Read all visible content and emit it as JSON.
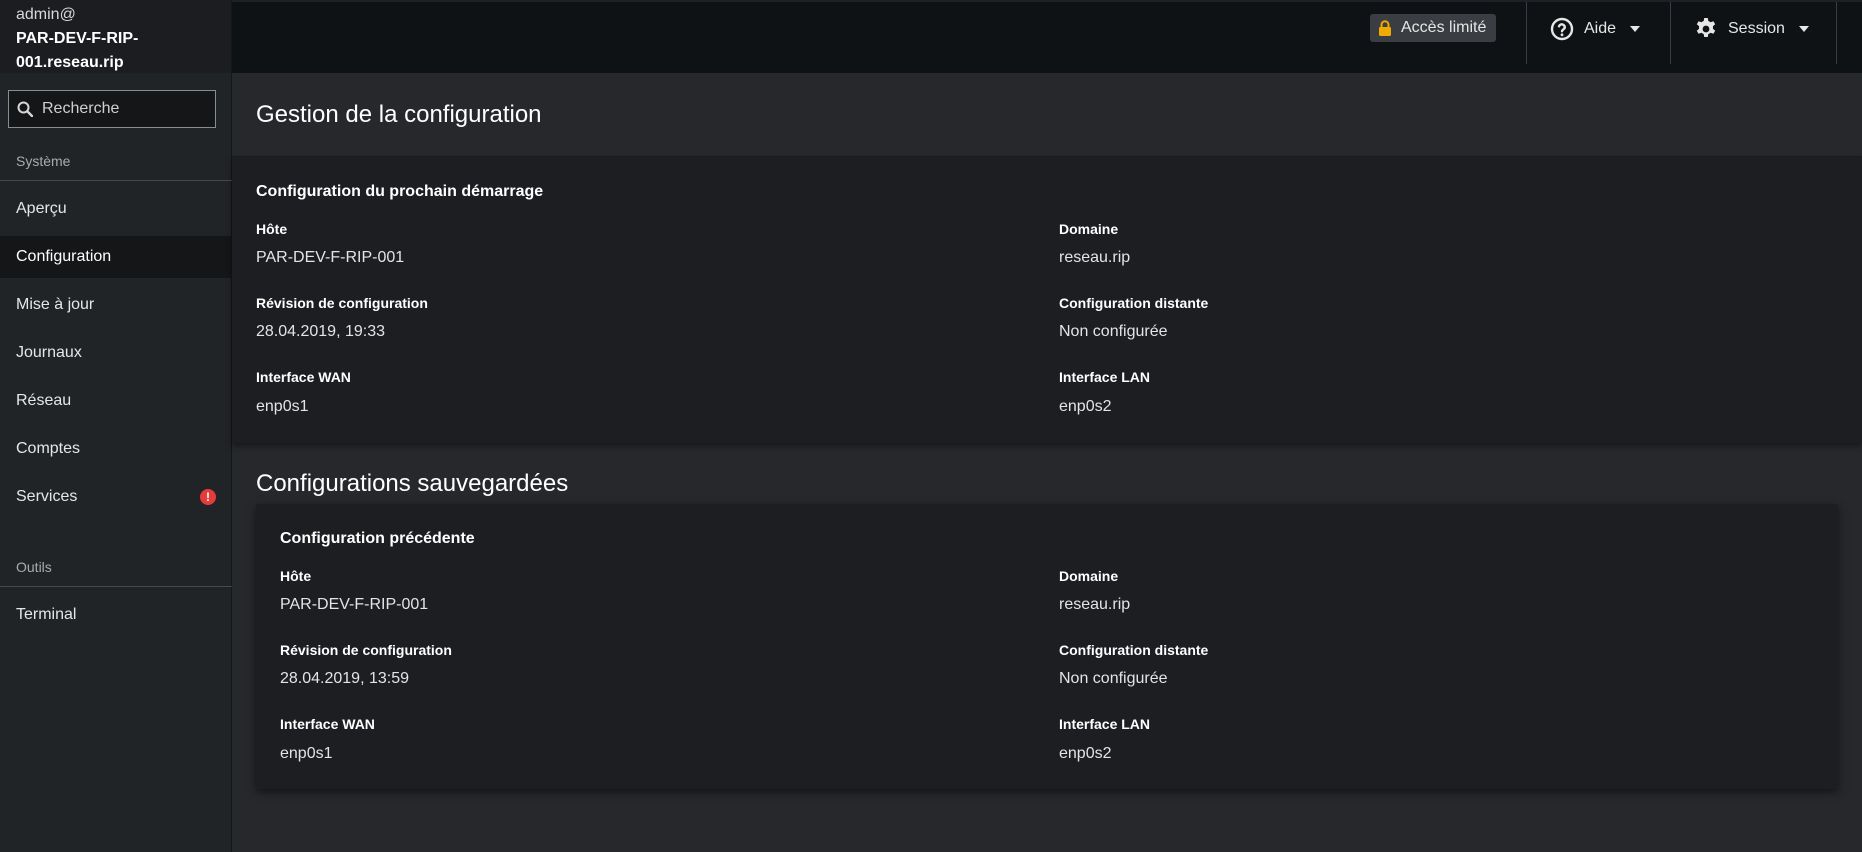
{
  "host": {
    "user": "admin@",
    "name_line1": "PAR-DEV-F-RIP-",
    "name_line2": "001.reseau.rip"
  },
  "search": {
    "placeholder": "Recherche"
  },
  "sidebar": {
    "system_label": "Système",
    "items": [
      {
        "label": "Aperçu"
      },
      {
        "label": "Configuration"
      },
      {
        "label": "Mise à jour"
      },
      {
        "label": "Journaux"
      },
      {
        "label": "Réseau"
      },
      {
        "label": "Comptes"
      },
      {
        "label": "Services",
        "badge": "!"
      }
    ],
    "tools_label": "Outils",
    "tools_items": [
      {
        "label": "Terminal"
      }
    ],
    "active_item": "Configuration"
  },
  "topbar": {
    "limited_access": "Accès limité",
    "help": "Aide",
    "session": "Session"
  },
  "page": {
    "title": "Gestion de la configuration"
  },
  "next_boot": {
    "title": "Configuration du prochain démarrage",
    "host_label": "Hôte",
    "host_value": "PAR-DEV-F-RIP-001",
    "domain_label": "Domaine",
    "domain_value": "reseau.rip",
    "revision_label": "Révision de configuration",
    "revision_value": "28.04.2019, 19:33",
    "remote_label": "Configuration distante",
    "remote_value": "Non configurée",
    "wan_label": "Interface WAN",
    "wan_value": "enp0s1",
    "lan_label": "Interface LAN",
    "lan_value": "enp0s2"
  },
  "saved": {
    "section_title": "Configurations sauvegardées",
    "previous": {
      "title": "Configuration précédente",
      "host_label": "Hôte",
      "host_value": "PAR-DEV-F-RIP-001",
      "domain_label": "Domaine",
      "domain_value": "reseau.rip",
      "revision_label": "Révision de configuration",
      "revision_value": "28.04.2019, 13:59",
      "remote_label": "Configuration distante",
      "remote_value": "Non configurée",
      "wan_label": "Interface WAN",
      "wan_value": "enp0s1",
      "lan_label": "Interface LAN",
      "lan_value": "enp0s2"
    }
  },
  "colors": {
    "badge": "#e53b3b",
    "lock": "#f0ab00",
    "sidebar_bg": "#212427",
    "topbar_bg": "#0f1214",
    "card_bg": "#1c1e21"
  },
  "icons": {
    "search": "search-icon",
    "lock": "lock-icon",
    "help": "question-circle-icon",
    "session": "gear-icon",
    "caret": "caret-down-icon",
    "badge": "exclamation-circle-icon"
  }
}
